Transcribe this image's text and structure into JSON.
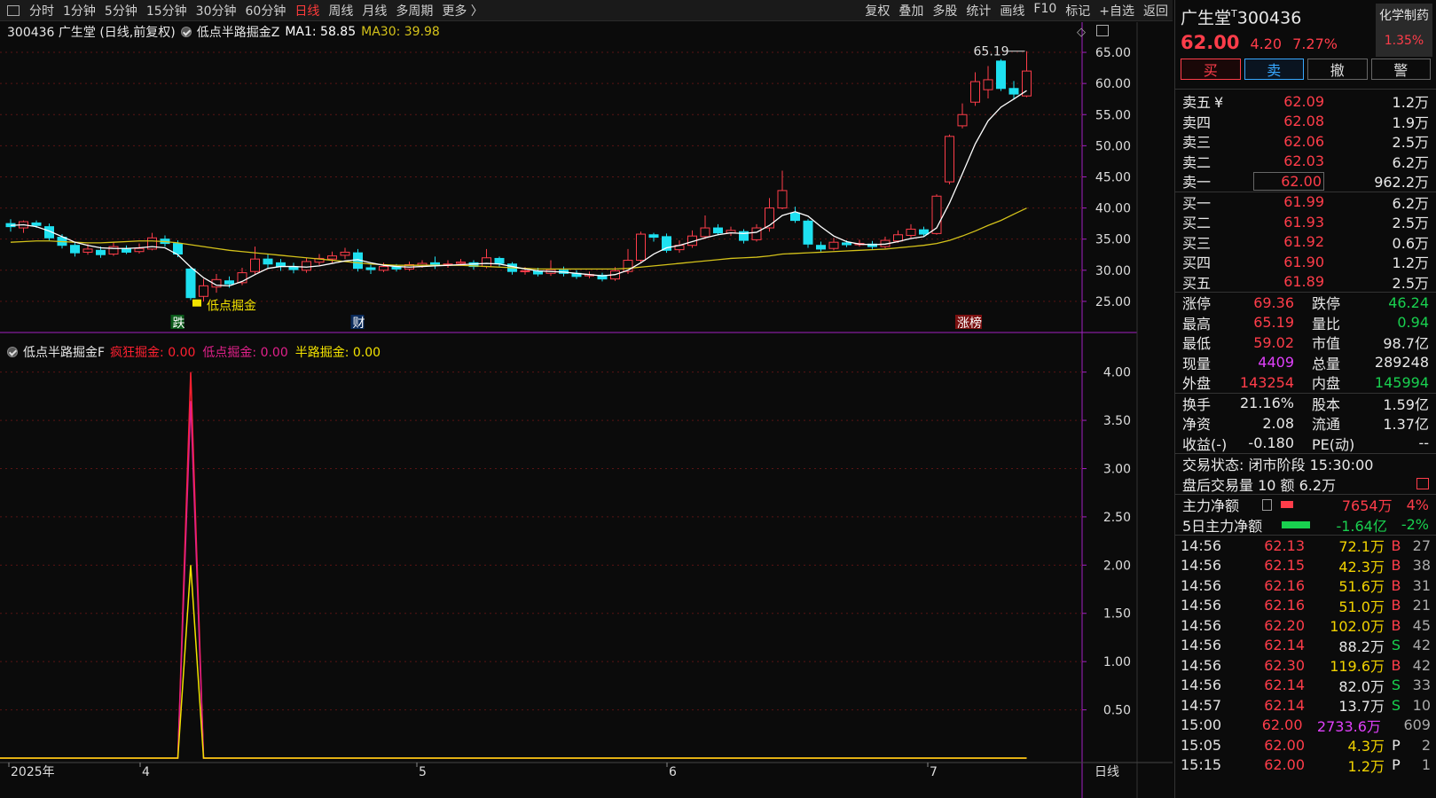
{
  "toolbar": {
    "left_items": [
      "分时",
      "1分钟",
      "5分钟",
      "15分钟",
      "30分钟",
      "60分钟",
      "日线",
      "周线",
      "月线",
      "多周期",
      "更多 〉"
    ],
    "active": "日线",
    "right_items": [
      "复权",
      "叠加",
      "多股",
      "统计",
      "画线",
      "F10",
      "标记",
      "+自选",
      "返回"
    ]
  },
  "main_legend": {
    "title": "300436 广生堂 (日线,前复权)",
    "indicator": "低点半路掘金Z",
    "ma1": "MA1: 58.85",
    "ma30": "MA30: 39.98"
  },
  "sub_legend": {
    "title": "低点半路掘金F",
    "items": [
      {
        "label": "疯狂掘金: 0.00",
        "color": "#ff2030"
      },
      {
        "label": "低点掘金: 0.00",
        "color": "#e0208a"
      },
      {
        "label": "半路掘金: 0.00",
        "color": "#f2e200"
      }
    ]
  },
  "annotations": {
    "high_label": "65.19",
    "marker_die": "跌",
    "marker_cai": "财",
    "marker_zhangbang": "涨榜",
    "signal_text": "低点掘金"
  },
  "price_axis": [
    "65.00",
    "60.00",
    "55.00",
    "50.00",
    "45.00",
    "40.00",
    "35.00",
    "30.00",
    "25.00"
  ],
  "sub_axis": [
    "4.00",
    "3.50",
    "3.00",
    "2.50",
    "2.00",
    "1.50",
    "1.00",
    "0.50"
  ],
  "date_axis": [
    {
      "label": "2025年"
    },
    {
      "label": "4"
    },
    {
      "label": "5"
    },
    {
      "label": "6"
    },
    {
      "label": "7"
    }
  ],
  "period_tag": "日线",
  "chart_data": {
    "type": "candlestick",
    "ylim": [
      20,
      67
    ],
    "candles": [
      [
        37.5,
        37.0,
        38.2,
        36.2
      ],
      [
        36.8,
        37.8,
        38.0,
        36.0
      ],
      [
        37.6,
        37.2,
        38.0,
        36.8
      ],
      [
        37.0,
        35.2,
        37.5,
        34.8
      ],
      [
        35.3,
        34.0,
        35.8,
        33.5
      ],
      [
        34.0,
        32.8,
        34.5,
        32.2
      ],
      [
        32.9,
        33.4,
        34.2,
        32.5
      ],
      [
        33.2,
        32.5,
        33.8,
        32.0
      ],
      [
        32.6,
        33.8,
        34.5,
        32.3
      ],
      [
        33.5,
        32.9,
        34.0,
        32.6
      ],
      [
        33.0,
        33.5,
        34.3,
        32.7
      ],
      [
        33.4,
        35.2,
        36.0,
        33.2
      ],
      [
        35.0,
        34.3,
        35.6,
        33.8
      ],
      [
        34.3,
        32.6,
        34.8,
        32.1
      ],
      [
        30.2,
        25.6,
        30.6,
        25.2
      ],
      [
        25.8,
        27.5,
        28.6,
        25.0
      ],
      [
        27.3,
        28.5,
        29.4,
        26.4
      ],
      [
        28.3,
        27.8,
        29.0,
        27.2
      ],
      [
        28.0,
        29.6,
        30.4,
        27.6
      ],
      [
        29.8,
        31.8,
        33.8,
        29.3
      ],
      [
        31.8,
        31.0,
        32.6,
        30.4
      ],
      [
        31.2,
        30.6,
        31.8,
        29.9
      ],
      [
        30.5,
        30.1,
        31.2,
        29.5
      ],
      [
        30.0,
        31.4,
        32.0,
        29.6
      ],
      [
        31.3,
        31.9,
        32.6,
        30.8
      ],
      [
        31.8,
        32.3,
        33.0,
        31.2
      ],
      [
        32.4,
        32.9,
        33.6,
        31.8
      ],
      [
        32.8,
        30.3,
        33.4,
        29.8
      ],
      [
        30.4,
        30.1,
        30.9,
        29.4
      ],
      [
        30.0,
        30.6,
        31.2,
        29.7
      ],
      [
        30.5,
        30.2,
        31.0,
        29.8
      ],
      [
        30.2,
        30.9,
        31.4,
        29.9
      ],
      [
        30.8,
        31.1,
        31.6,
        30.4
      ],
      [
        31.2,
        30.8,
        32.2,
        30.2
      ],
      [
        30.9,
        31.0,
        31.6,
        30.4
      ],
      [
        31.1,
        31.3,
        31.8,
        30.7
      ],
      [
        31.2,
        30.6,
        31.6,
        30.1
      ],
      [
        30.6,
        32.0,
        33.4,
        30.3
      ],
      [
        31.9,
        31.1,
        32.2,
        30.6
      ],
      [
        31.0,
        29.8,
        31.3,
        29.3
      ],
      [
        29.8,
        29.9,
        30.5,
        29.3
      ],
      [
        29.9,
        29.4,
        30.4,
        29.0
      ],
      [
        29.5,
        30.1,
        31.6,
        29.1
      ],
      [
        30.0,
        29.5,
        30.6,
        29.0
      ],
      [
        29.5,
        29.0,
        30.0,
        28.6
      ],
      [
        29.1,
        29.3,
        29.8,
        28.7
      ],
      [
        29.2,
        28.6,
        29.6,
        28.2
      ],
      [
        28.6,
        29.9,
        30.5,
        28.3
      ],
      [
        29.8,
        31.6,
        33.4,
        29.4
      ],
      [
        31.6,
        35.8,
        36.2,
        31.2
      ],
      [
        35.7,
        35.3,
        36.0,
        34.6
      ],
      [
        35.4,
        33.2,
        35.9,
        32.8
      ],
      [
        33.3,
        34.0,
        34.8,
        32.8
      ],
      [
        34.0,
        35.5,
        36.4,
        33.6
      ],
      [
        35.4,
        36.8,
        38.8,
        35.0
      ],
      [
        36.8,
        36.0,
        37.4,
        35.6
      ],
      [
        36.0,
        36.4,
        37.0,
        35.5
      ],
      [
        36.2,
        34.8,
        36.6,
        34.3
      ],
      [
        34.9,
        36.8,
        37.4,
        34.6
      ],
      [
        36.8,
        40.0,
        41.6,
        36.2
      ],
      [
        40.0,
        42.8,
        46.0,
        39.8
      ],
      [
        39.2,
        38.0,
        40.2,
        37.6
      ],
      [
        37.9,
        34.2,
        38.2,
        33.6
      ],
      [
        34.0,
        33.4,
        34.6,
        33.0
      ],
      [
        33.5,
        34.5,
        35.2,
        33.2
      ],
      [
        34.4,
        34.1,
        34.8,
        33.7
      ],
      [
        34.1,
        34.3,
        34.9,
        33.8
      ],
      [
        34.2,
        33.8,
        34.7,
        33.4
      ],
      [
        33.8,
        34.8,
        35.4,
        33.5
      ],
      [
        34.7,
        35.7,
        36.4,
        34.4
      ],
      [
        35.6,
        36.6,
        37.4,
        35.2
      ],
      [
        36.5,
        35.8,
        37.0,
        35.4
      ],
      [
        35.9,
        41.9,
        42.2,
        35.7
      ],
      [
        44.2,
        51.5,
        51.8,
        43.8
      ],
      [
        53.2,
        55.0,
        56.8,
        52.8
      ],
      [
        57.0,
        60.3,
        61.8,
        56.4
      ],
      [
        59.0,
        60.6,
        62.8,
        57.6
      ],
      [
        63.6,
        59.2,
        63.9,
        58.8
      ],
      [
        59.2,
        58.3,
        60.4,
        57.4
      ],
      [
        58.0,
        62.0,
        65.19,
        57.8
      ]
    ],
    "ma30": [
      34.5,
      34.6,
      34.7,
      34.7,
      34.6,
      34.5,
      34.4,
      34.4,
      34.5,
      34.6,
      34.7,
      34.7,
      34.6,
      34.4,
      34.1,
      33.8,
      33.5,
      33.2,
      33.0,
      32.8,
      32.6,
      32.4,
      32.2,
      32.0,
      31.8,
      31.6,
      31.4,
      31.2,
      31.0,
      30.9,
      30.8,
      30.8,
      30.8,
      30.8,
      30.8,
      30.8,
      30.7,
      30.6,
      30.5,
      30.4,
      30.3,
      30.2,
      30.2,
      30.2,
      30.2,
      30.2,
      30.2,
      30.2,
      30.3,
      30.5,
      30.7,
      30.9,
      31.1,
      31.3,
      31.5,
      31.7,
      31.9,
      32.0,
      32.1,
      32.3,
      32.6,
      32.7,
      32.8,
      32.9,
      33.0,
      33.1,
      33.2,
      33.3,
      33.4,
      33.6,
      33.8,
      34.0,
      34.3,
      34.8,
      35.5,
      36.3,
      37.2,
      38.0,
      39.0,
      39.98
    ],
    "ma1": [
      37.2,
      37.3,
      37.0,
      36.3,
      35.4,
      34.5,
      34.0,
      33.6,
      33.5,
      33.5,
      33.6,
      33.8,
      33.6,
      32.5,
      30.5,
      28.8,
      27.6,
      27.5,
      28.2,
      29.3,
      30.3,
      30.6,
      30.6,
      30.5,
      30.7,
      31.1,
      31.5,
      31.7,
      31.2,
      30.8,
      30.6,
      30.5,
      30.6,
      30.7,
      30.8,
      30.9,
      31.0,
      31.1,
      31.0,
      30.6,
      30.2,
      29.9,
      29.8,
      29.7,
      29.5,
      29.3,
      29.1,
      29.3,
      30.0,
      31.2,
      32.6,
      33.6,
      34.0,
      34.6,
      35.2,
      35.7,
      36.0,
      35.9,
      36.1,
      37.2,
      38.8,
      39.4,
      38.7,
      37.0,
      35.5,
      34.6,
      34.2,
      34.1,
      34.2,
      34.6,
      35.1,
      35.4,
      36.8,
      40.8,
      45.5,
      50.3,
      54.0,
      56.2,
      57.5,
      58.85
    ],
    "signal": {
      "index": 14,
      "crazy": 4.0,
      "low": 3.7,
      "half": 2.0
    },
    "sub_ylim": [
      0,
      4.3
    ]
  },
  "panel": {
    "name": "广生堂",
    "code": "300436",
    "sup": "T",
    "sector": "化学制药",
    "sector_pct": "1.35%",
    "price": "62.00",
    "change": "4.20",
    "change_pct": "7.27%",
    "buttons": [
      "买",
      "卖",
      "撤",
      "警"
    ],
    "asks": [
      {
        "label": "卖五",
        "price": "62.09",
        "vol": "1.2万"
      },
      {
        "label": "卖四",
        "price": "62.08",
        "vol": "1.9万"
      },
      {
        "label": "卖三",
        "price": "62.06",
        "vol": "2.5万"
      },
      {
        "label": "卖二",
        "price": "62.03",
        "vol": "6.2万"
      },
      {
        "label": "卖一",
        "price": "62.00",
        "vol": "962.2万"
      }
    ],
    "bids": [
      {
        "label": "买一",
        "price": "61.99",
        "vol": "6.2万"
      },
      {
        "label": "买二",
        "price": "61.93",
        "vol": "2.5万"
      },
      {
        "label": "买三",
        "price": "61.92",
        "vol": "0.6万"
      },
      {
        "label": "买四",
        "price": "61.90",
        "vol": "1.2万"
      },
      {
        "label": "买五",
        "price": "61.89",
        "vol": "2.5万"
      }
    ],
    "stats1": [
      {
        "l1": "涨停",
        "v1": "69.36",
        "c1": "red",
        "l2": "跌停",
        "v2": "46.24",
        "c2": "green"
      },
      {
        "l1": "最高",
        "v1": "65.19",
        "c1": "red",
        "l2": "量比",
        "v2": "0.94",
        "c2": "green"
      },
      {
        "l1": "最低",
        "v1": "59.02",
        "c1": "red",
        "l2": "市值",
        "v2": "98.7亿",
        "c2": "white"
      },
      {
        "l1": "现量",
        "v1": "4409",
        "c1": "magenta",
        "l2": "总量",
        "v2": "289248",
        "c2": "white"
      },
      {
        "l1": "外盘",
        "v1": "143254",
        "c1": "red",
        "l2": "内盘",
        "v2": "145994",
        "c2": "green"
      }
    ],
    "stats2": [
      {
        "l1": "换手",
        "v1": "21.16%",
        "l2": "股本",
        "v2": "1.59亿"
      },
      {
        "l1": "净资",
        "v1": "2.08",
        "l2": "流通",
        "v2": "1.37亿"
      },
      {
        "l1": "收益(-)",
        "v1": "-0.180",
        "l2": "PE(动)",
        "v2": "--"
      }
    ],
    "trade_status": "交易状态: 闭市阶段 15:30:00",
    "after_hours": "盘后交易量 10 额 6.2万",
    "main_flow": {
      "label": "主力净额",
      "value": "7654万",
      "pct": "4%"
    },
    "flow5": {
      "label": "5日主力净额",
      "value": "-1.64亿",
      "pct": "-2%"
    },
    "trades": [
      {
        "t": "14:56",
        "p": "62.13",
        "v": "72.1万",
        "bs": "B",
        "n": "27"
      },
      {
        "t": "14:56",
        "p": "62.15",
        "v": "42.3万",
        "bs": "B",
        "n": "38"
      },
      {
        "t": "14:56",
        "p": "62.16",
        "v": "51.6万",
        "bs": "B",
        "n": "31"
      },
      {
        "t": "14:56",
        "p": "62.16",
        "v": "51.0万",
        "bs": "B",
        "n": "21"
      },
      {
        "t": "14:56",
        "p": "62.20",
        "v": "102.0万",
        "bs": "B",
        "n": "45"
      },
      {
        "t": "14:56",
        "p": "62.14",
        "v": "88.2万",
        "bs": "S",
        "n": "42"
      },
      {
        "t": "14:56",
        "p": "62.30",
        "v": "119.6万",
        "bs": "B",
        "n": "42"
      },
      {
        "t": "14:56",
        "p": "62.14",
        "v": "82.0万",
        "bs": "S",
        "n": "33"
      },
      {
        "t": "14:57",
        "p": "62.14",
        "v": "13.7万",
        "bs": "S",
        "n": "10"
      },
      {
        "t": "15:00",
        "p": "62.00",
        "v": "2733.6万",
        "bs": "",
        "n": "609"
      },
      {
        "t": "15:05",
        "p": "62.00",
        "v": "4.3万",
        "bs": "P",
        "n": "2"
      },
      {
        "t": "15:15",
        "p": "62.00",
        "v": "1.2万",
        "bs": "P",
        "n": "1"
      }
    ]
  },
  "colors": {
    "up": "#ff3d4a",
    "down": "#1ee0f0",
    "ma30": "#d4c21a",
    "ma1": "#ffffff",
    "grid": "#5a1414",
    "divider": "#a020c0"
  }
}
